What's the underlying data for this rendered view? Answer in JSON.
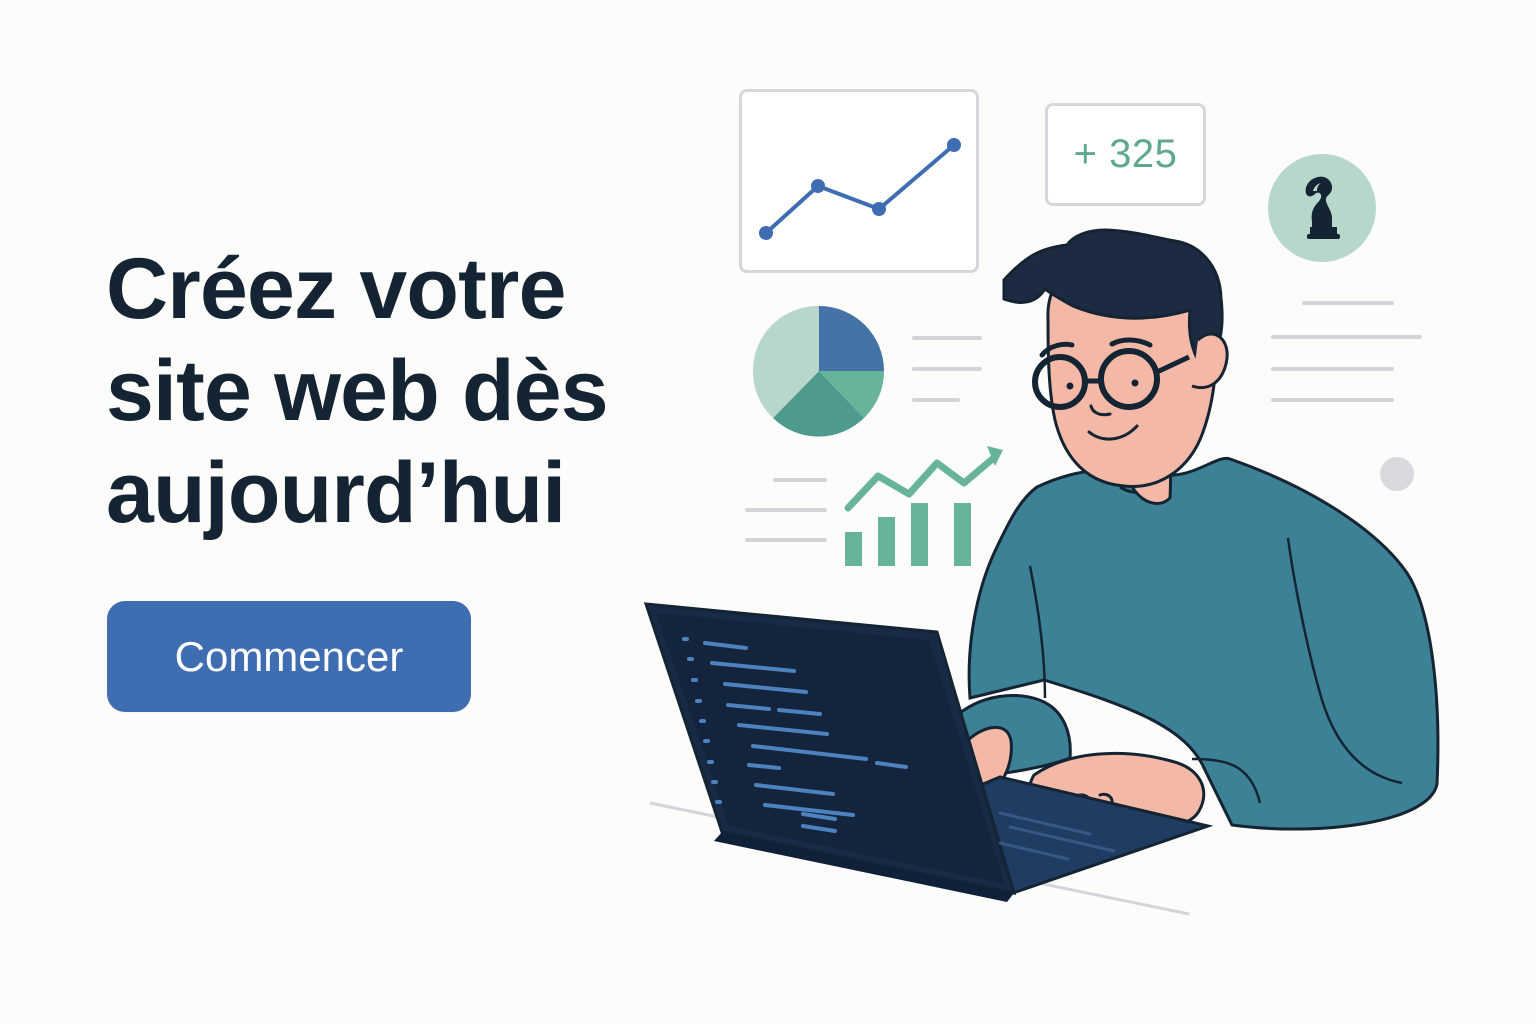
{
  "hero": {
    "title_lines": [
      "Créez votre",
      "site web dès",
      "aujourd’hui"
    ],
    "button_label": "Commencer"
  },
  "stats": {
    "value": "+ 325"
  },
  "icons": {
    "chess": "chess-knight-icon",
    "line_chart": "line-chart-icon",
    "pie_chart": "pie-chart-icon",
    "bar_chart": "bar-chart-icon",
    "code_laptop": "code-laptop-icon"
  },
  "colors": {
    "title": "#142433",
    "button": "#3e6db2",
    "accent_green": "#5ea98b",
    "line_chart": "#3e6db2",
    "pie_blue": "#4673a7",
    "pie_green": "#67b49b",
    "pie_teal": "#4e9a8f",
    "pie_mint": "#b8d7cb",
    "shirt": "#3d8197",
    "laptop": "#182a46"
  }
}
